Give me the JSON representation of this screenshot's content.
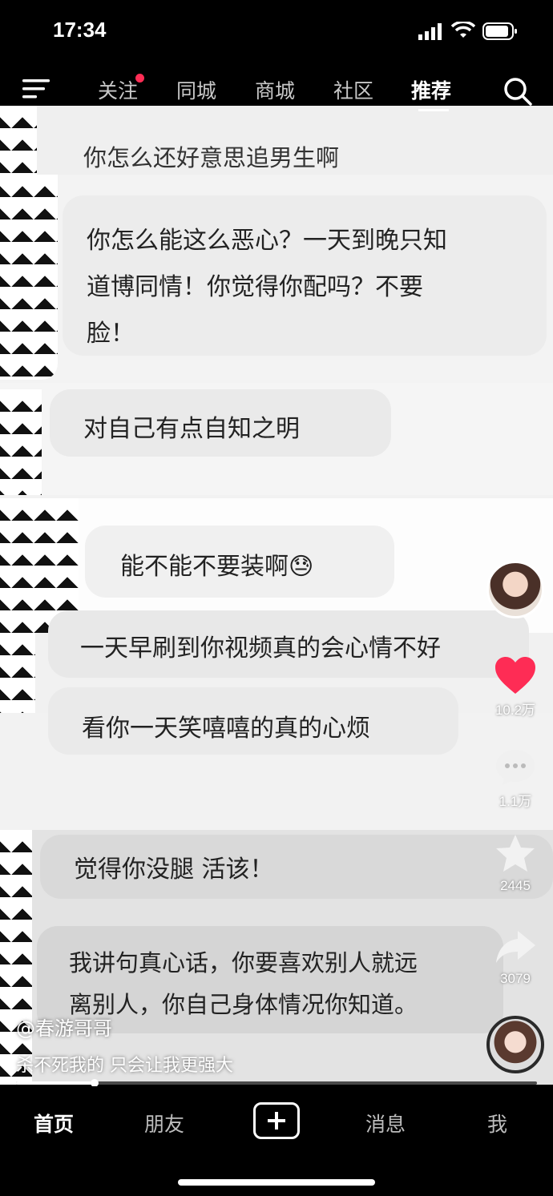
{
  "status_bar": {
    "time": "17:34"
  },
  "top_nav": {
    "tabs": [
      {
        "label": "关注",
        "has_dot": true
      },
      {
        "label": "同城"
      },
      {
        "label": "商城"
      },
      {
        "label": "社区"
      },
      {
        "label": "推荐",
        "active": true
      }
    ]
  },
  "video": {
    "messages": [
      {
        "lines": [
          "你怎么还好意思追男生啊"
        ]
      },
      {
        "lines": [
          "你怎么能这么恶心？一天到晚只知",
          "道博同情！你觉得你配吗？不要",
          "脸！"
        ]
      },
      {
        "lines": [
          "对自己有点自知之明"
        ]
      },
      {
        "lines": [
          "能不能不要装啊😓"
        ]
      },
      {
        "lines": [
          "一天早刷到你视频真的会心情不好"
        ]
      },
      {
        "lines": [
          "看你一天笑嘻嘻的真的心烦"
        ]
      },
      {
        "lines": [
          "觉得你没腿 活该！"
        ]
      },
      {
        "lines": [
          "我讲句真心话，你要喜欢别人就远",
          "离别人，你自己身体情况你知道。"
        ]
      }
    ],
    "author": "@春游哥哥",
    "caption": "杀不死我的 只会让我更强大",
    "progress": 0.15
  },
  "rail": {
    "likes": "10.2万",
    "comments": "1.1万",
    "favorites": "2445",
    "shares": "3079",
    "like_color": "#fe2c55"
  },
  "bottom_nav": {
    "home": "首页",
    "friends": "朋友",
    "messages": "消息",
    "me": "我"
  }
}
